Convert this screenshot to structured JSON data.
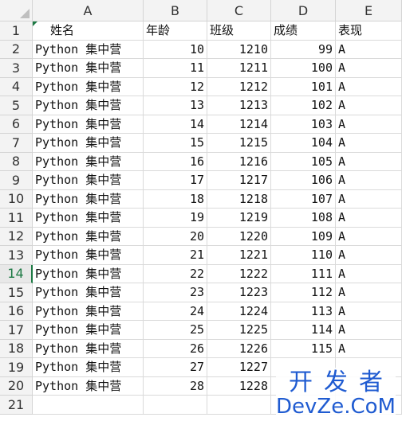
{
  "columns": [
    "A",
    "B",
    "C",
    "D",
    "E"
  ],
  "row_numbers": [
    "1",
    "2",
    "3",
    "4",
    "5",
    "6",
    "7",
    "8",
    "9",
    "10",
    "11",
    "12",
    "13",
    "14",
    "15",
    "16",
    "17",
    "18",
    "19",
    "20",
    "21"
  ],
  "active_row": "14",
  "header_row": [
    "姓名",
    "年龄",
    "班级",
    "成绩",
    "表现"
  ],
  "rows": [
    [
      "Python 集中营",
      "10",
      "1210",
      "99",
      "A"
    ],
    [
      "Python 集中营",
      "11",
      "1211",
      "100",
      "A"
    ],
    [
      "Python 集中营",
      "12",
      "1212",
      "101",
      "A"
    ],
    [
      "Python 集中营",
      "13",
      "1213",
      "102",
      "A"
    ],
    [
      "Python 集中营",
      "14",
      "1214",
      "103",
      "A"
    ],
    [
      "Python 集中营",
      "15",
      "1215",
      "104",
      "A"
    ],
    [
      "Python 集中营",
      "16",
      "1216",
      "105",
      "A"
    ],
    [
      "Python 集中营",
      "17",
      "1217",
      "106",
      "A"
    ],
    [
      "Python 集中营",
      "18",
      "1218",
      "107",
      "A"
    ],
    [
      "Python 集中营",
      "19",
      "1219",
      "108",
      "A"
    ],
    [
      "Python 集中营",
      "20",
      "1220",
      "109",
      "A"
    ],
    [
      "Python 集中营",
      "21",
      "1221",
      "110",
      "A"
    ],
    [
      "Python 集中营",
      "22",
      "1222",
      "111",
      "A"
    ],
    [
      "Python 集中营",
      "23",
      "1223",
      "112",
      "A"
    ],
    [
      "Python 集中营",
      "24",
      "1224",
      "113",
      "A"
    ],
    [
      "Python 集中营",
      "25",
      "1225",
      "114",
      "A"
    ],
    [
      "Python 集中营",
      "26",
      "1226",
      "115",
      "A"
    ],
    [
      "Python 集中营",
      "27",
      "1227",
      "",
      ""
    ],
    [
      "Python 集中营",
      "28",
      "1228",
      "",
      ""
    ]
  ],
  "watermark": {
    "top": "开发者",
    "bottom": "DevZe.CoM"
  },
  "colors": {
    "accent": "#1e7a45",
    "watermark": "#1f5bd1",
    "header_bg": "#f3f3f3",
    "gridline": "#dadada"
  }
}
